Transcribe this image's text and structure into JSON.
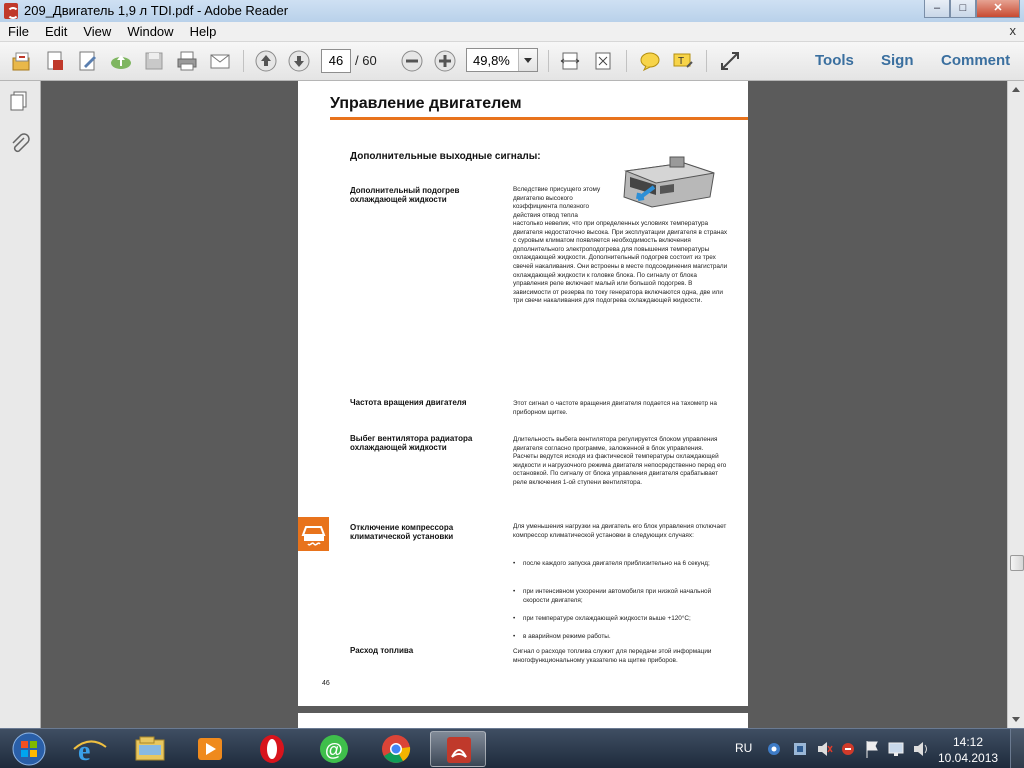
{
  "window": {
    "title": "209_Двигатель 1,9 л TDI.pdf - Adobe Reader"
  },
  "menu": {
    "items": [
      "File",
      "Edit",
      "View",
      "Window",
      "Help"
    ],
    "close": "x"
  },
  "toolbar": {
    "page_current": "46",
    "page_total": "/ 60",
    "zoom": "49,8%",
    "tools_label": "Tools",
    "sign_label": "Sign",
    "comment_label": "Comment"
  },
  "document": {
    "page_title": "Управление двигателем",
    "section_heading": "Дополнительные выходные сигналы:",
    "items": [
      {
        "label": "Дополнительный подогрев охлаждающей жидкости",
        "text_intro": "Вследствие присущего этому двигателю высокого коэффициента полезного действия отвод тепла",
        "text": "настолько невелик, что при определенных условиях температура двигателя недостаточно высока. При эксплуатации двигателя в странах с суровым климатом появляется необходимость включения дополнительного электроподогрева для повышения температуры охлаждающей жидкости. Дополнительный подогрев состоит из трех свечей накаливания. Они встроены в месте подсоединения магистрали охлаждающей жидкости к головке блока. По сигналу от блока управления реле включает малый или большой подогрев. В зависимости от резерва по току генератора включаются одна, две или три свечи накаливания для подогрева охлаждающей жидкости."
      },
      {
        "label": "Частота вращения двигателя",
        "text": "Этот сигнал о частоте вращения двигателя подается на тахометр на приборном щитке."
      },
      {
        "label": "Выбег вентилятора радиатора охлаждающей жидкости",
        "text": "Длительность выбега вентилятора регулируется блоком управления двигателя согласно программе, заложенной в блок управления. Расчеты ведутся исходя из фактической температуры охлаждающей жидкости и нагрузочного режима двигателя непосредственно перед его остановкой. По сигналу от блока управления двигателя срабатывает реле включения 1-ой ступени вентилятора."
      },
      {
        "label": "Отключение компрессора климатической установки",
        "text": "Для уменьшения нагрузки на двигатель его блок управления отключает компрессор климатической установки в следующих случаях:",
        "bullets": [
          "после каждого запуска двигателя приблизительно на 6 секунд;",
          "при интенсивном ускорении автомобиля при низкой начальной скорости двигателя;",
          "при температуре охлаждающей жидкости выше +120°C;",
          "в аварийном режиме работы."
        ]
      },
      {
        "label": "Расход топлива",
        "text": "Сигнал о расходе топлива служит для передачи этой информации многофункциональному указателю на щитке приборов."
      }
    ],
    "page_number": "46"
  },
  "taskbar": {
    "lang": "RU",
    "time": "14:12",
    "date": "10.04.2013"
  },
  "colors": {
    "accent": "#e8731c",
    "link": "#3a6f9f"
  }
}
